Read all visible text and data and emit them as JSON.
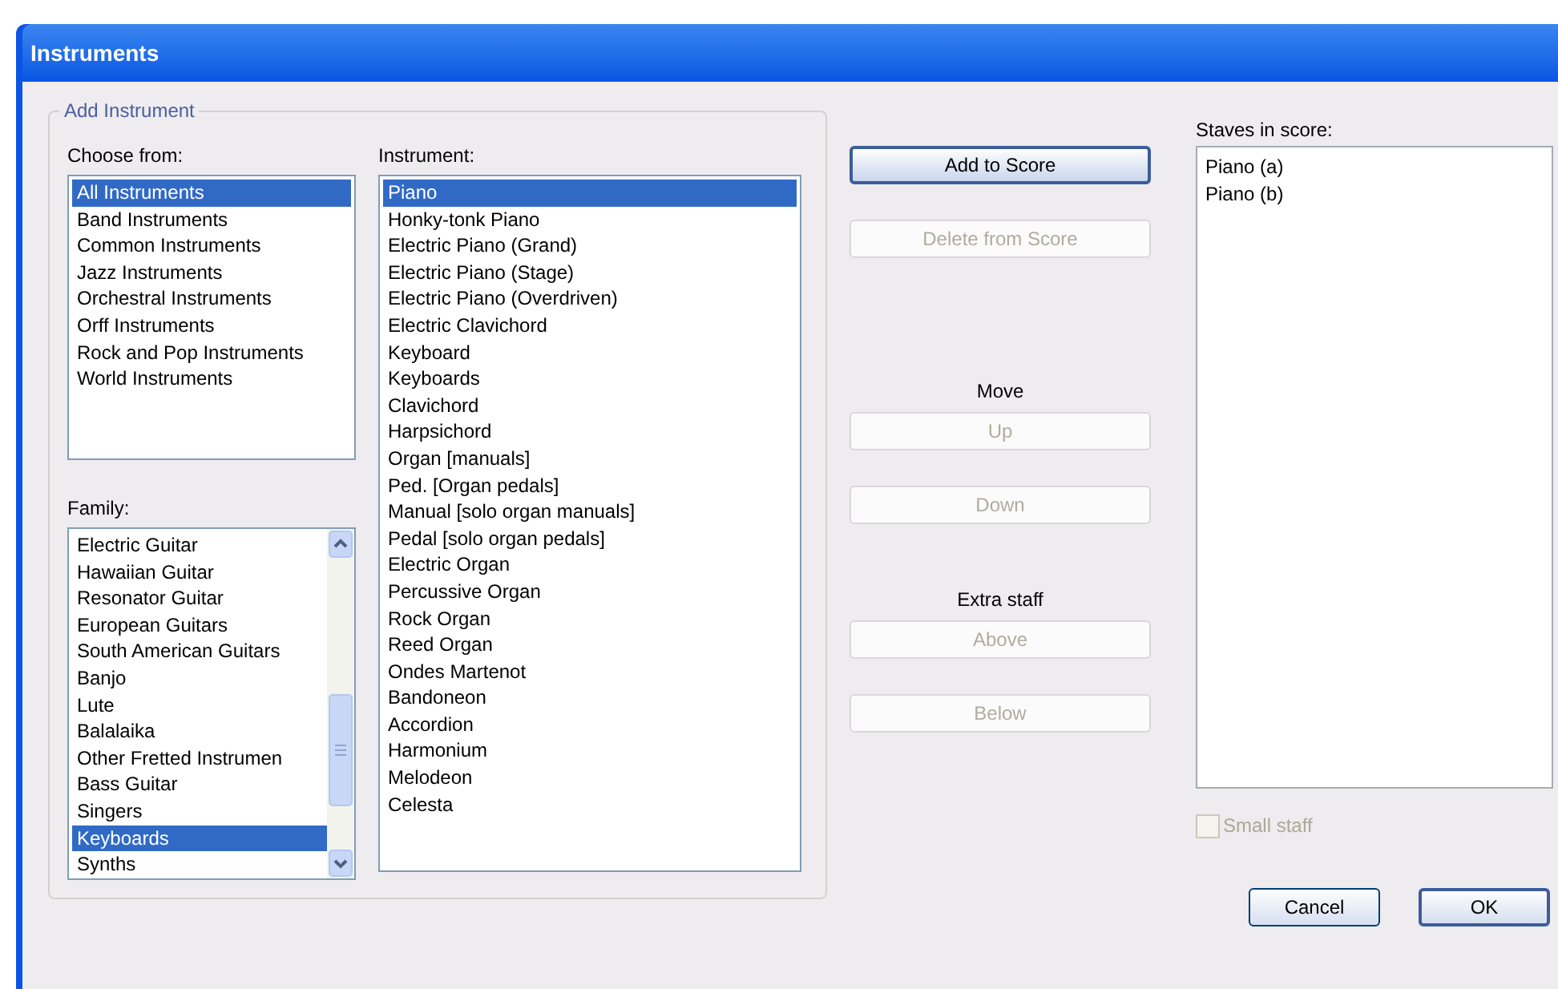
{
  "window": {
    "title": "Instruments"
  },
  "group": {
    "title": "Add Instrument"
  },
  "choose_from": {
    "label": "Choose from:",
    "items": [
      {
        "text": "All Instruments",
        "selected": true
      },
      {
        "text": "Band Instruments",
        "selected": false
      },
      {
        "text": "Common Instruments",
        "selected": false
      },
      {
        "text": "Jazz Instruments",
        "selected": false
      },
      {
        "text": "Orchestral Instruments",
        "selected": false
      },
      {
        "text": "Orff Instruments",
        "selected": false
      },
      {
        "text": "Rock and Pop Instruments",
        "selected": false
      },
      {
        "text": "World Instruments",
        "selected": false
      }
    ]
  },
  "family": {
    "label": "Family:",
    "items": [
      {
        "text": "Electric Guitar",
        "selected": false
      },
      {
        "text": "Hawaiian Guitar",
        "selected": false
      },
      {
        "text": "Resonator Guitar",
        "selected": false
      },
      {
        "text": "European Guitars",
        "selected": false
      },
      {
        "text": "South American Guitars",
        "selected": false
      },
      {
        "text": "Banjo",
        "selected": false
      },
      {
        "text": "Lute",
        "selected": false
      },
      {
        "text": "Balalaika",
        "selected": false
      },
      {
        "text": "Other Fretted Instrumen",
        "selected": false
      },
      {
        "text": "Bass Guitar",
        "selected": false
      },
      {
        "text": "Singers",
        "selected": false
      },
      {
        "text": "Keyboards",
        "selected": true
      },
      {
        "text": "Synths",
        "selected": false
      }
    ]
  },
  "instrument": {
    "label": "Instrument:",
    "items": [
      {
        "text": "Piano",
        "selected": true
      },
      {
        "text": "Honky-tonk Piano",
        "selected": false
      },
      {
        "text": "Electric Piano (Grand)",
        "selected": false
      },
      {
        "text": "Electric Piano (Stage)",
        "selected": false
      },
      {
        "text": "Electric Piano (Overdriven)",
        "selected": false
      },
      {
        "text": "Electric Clavichord",
        "selected": false
      },
      {
        "text": "Keyboard",
        "selected": false
      },
      {
        "text": "Keyboards",
        "selected": false
      },
      {
        "text": "Clavichord",
        "selected": false
      },
      {
        "text": "Harpsichord",
        "selected": false
      },
      {
        "text": "Organ [manuals]",
        "selected": false
      },
      {
        "text": "Ped. [Organ pedals]",
        "selected": false
      },
      {
        "text": "Manual [solo organ manuals]",
        "selected": false
      },
      {
        "text": "Pedal [solo organ pedals]",
        "selected": false
      },
      {
        "text": "Electric Organ",
        "selected": false
      },
      {
        "text": "Percussive Organ",
        "selected": false
      },
      {
        "text": "Rock Organ",
        "selected": false
      },
      {
        "text": "Reed Organ",
        "selected": false
      },
      {
        "text": "Ondes Martenot",
        "selected": false
      },
      {
        "text": "Bandoneon",
        "selected": false
      },
      {
        "text": "Accordion",
        "selected": false
      },
      {
        "text": "Harmonium",
        "selected": false
      },
      {
        "text": "Melodeon",
        "selected": false
      },
      {
        "text": "Celesta",
        "selected": false
      }
    ]
  },
  "actions": [
    {
      "kind": "button",
      "text": "Add to Score",
      "disabled": false
    },
    {
      "kind": "button",
      "text": "Delete from Score",
      "disabled": true
    },
    {
      "kind": "heading",
      "text": "Move"
    },
    {
      "kind": "button",
      "text": "Up",
      "disabled": true
    },
    {
      "kind": "button",
      "text": "Down",
      "disabled": true
    },
    {
      "kind": "heading",
      "text": "Extra staff"
    },
    {
      "kind": "button",
      "text": "Above",
      "disabled": true
    },
    {
      "kind": "button",
      "text": "Below",
      "disabled": true
    }
  ],
  "staves": {
    "label": "Staves in score:",
    "items": [
      {
        "text": "Piano (a)",
        "selected": false
      },
      {
        "text": "Piano (b)",
        "selected": false
      }
    ]
  },
  "small_staff": {
    "label": "Small staff",
    "checked": false,
    "disabled": true
  },
  "buttons": [
    {
      "text": "Cancel",
      "default": false
    },
    {
      "text": "OK",
      "default": true
    }
  ]
}
